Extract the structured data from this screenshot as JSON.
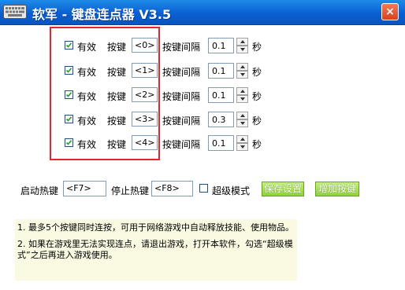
{
  "window": {
    "title": "软军 - 键盘连点器 V3.5",
    "close_label": "×"
  },
  "rows": [
    {
      "checked": true,
      "valid_label": "有效",
      "key_label": "按键",
      "key_value": "<0>",
      "interval_label": "按键间隔",
      "interval_value": "0.1",
      "unit": "秒"
    },
    {
      "checked": true,
      "valid_label": "有效",
      "key_label": "按键",
      "key_value": "<1>",
      "interval_label": "按键间隔",
      "interval_value": "0.1",
      "unit": "秒"
    },
    {
      "checked": true,
      "valid_label": "有效",
      "key_label": "按键",
      "key_value": "<2>",
      "interval_label": "按键间隔",
      "interval_value": "0.1",
      "unit": "秒"
    },
    {
      "checked": true,
      "valid_label": "有效",
      "key_label": "按键",
      "key_value": "<3>",
      "interval_label": "按键间隔",
      "interval_value": "0.3",
      "unit": "秒"
    },
    {
      "checked": true,
      "valid_label": "有效",
      "key_label": "按键",
      "key_value": "<4>",
      "interval_label": "按键间隔",
      "interval_value": "0.1",
      "unit": "秒"
    }
  ],
  "controls": {
    "start_hotkey_label": "启动热键",
    "start_hotkey_value": "<F7>",
    "stop_hotkey_label": "停止热键",
    "stop_hotkey_value": "<F8>",
    "super_mode_label": "超级模式",
    "super_mode_checked": false,
    "save_button": "保存设置",
    "add_button": "增加按键"
  },
  "info": {
    "line1": "1. 最多5个按键同时连按，可用于网络游戏中自动释放技能、使用物品。",
    "line2": "2. 如果在游戏里无法实现连点，请退出游戏，打开本软件，勾选“超级模式”之后再进入游戏使用。"
  },
  "colors": {
    "title_bar": "#0a5fd1",
    "highlight": "#e3262e",
    "button_green": "#8fd23a",
    "info_bg": "#fafae2"
  }
}
